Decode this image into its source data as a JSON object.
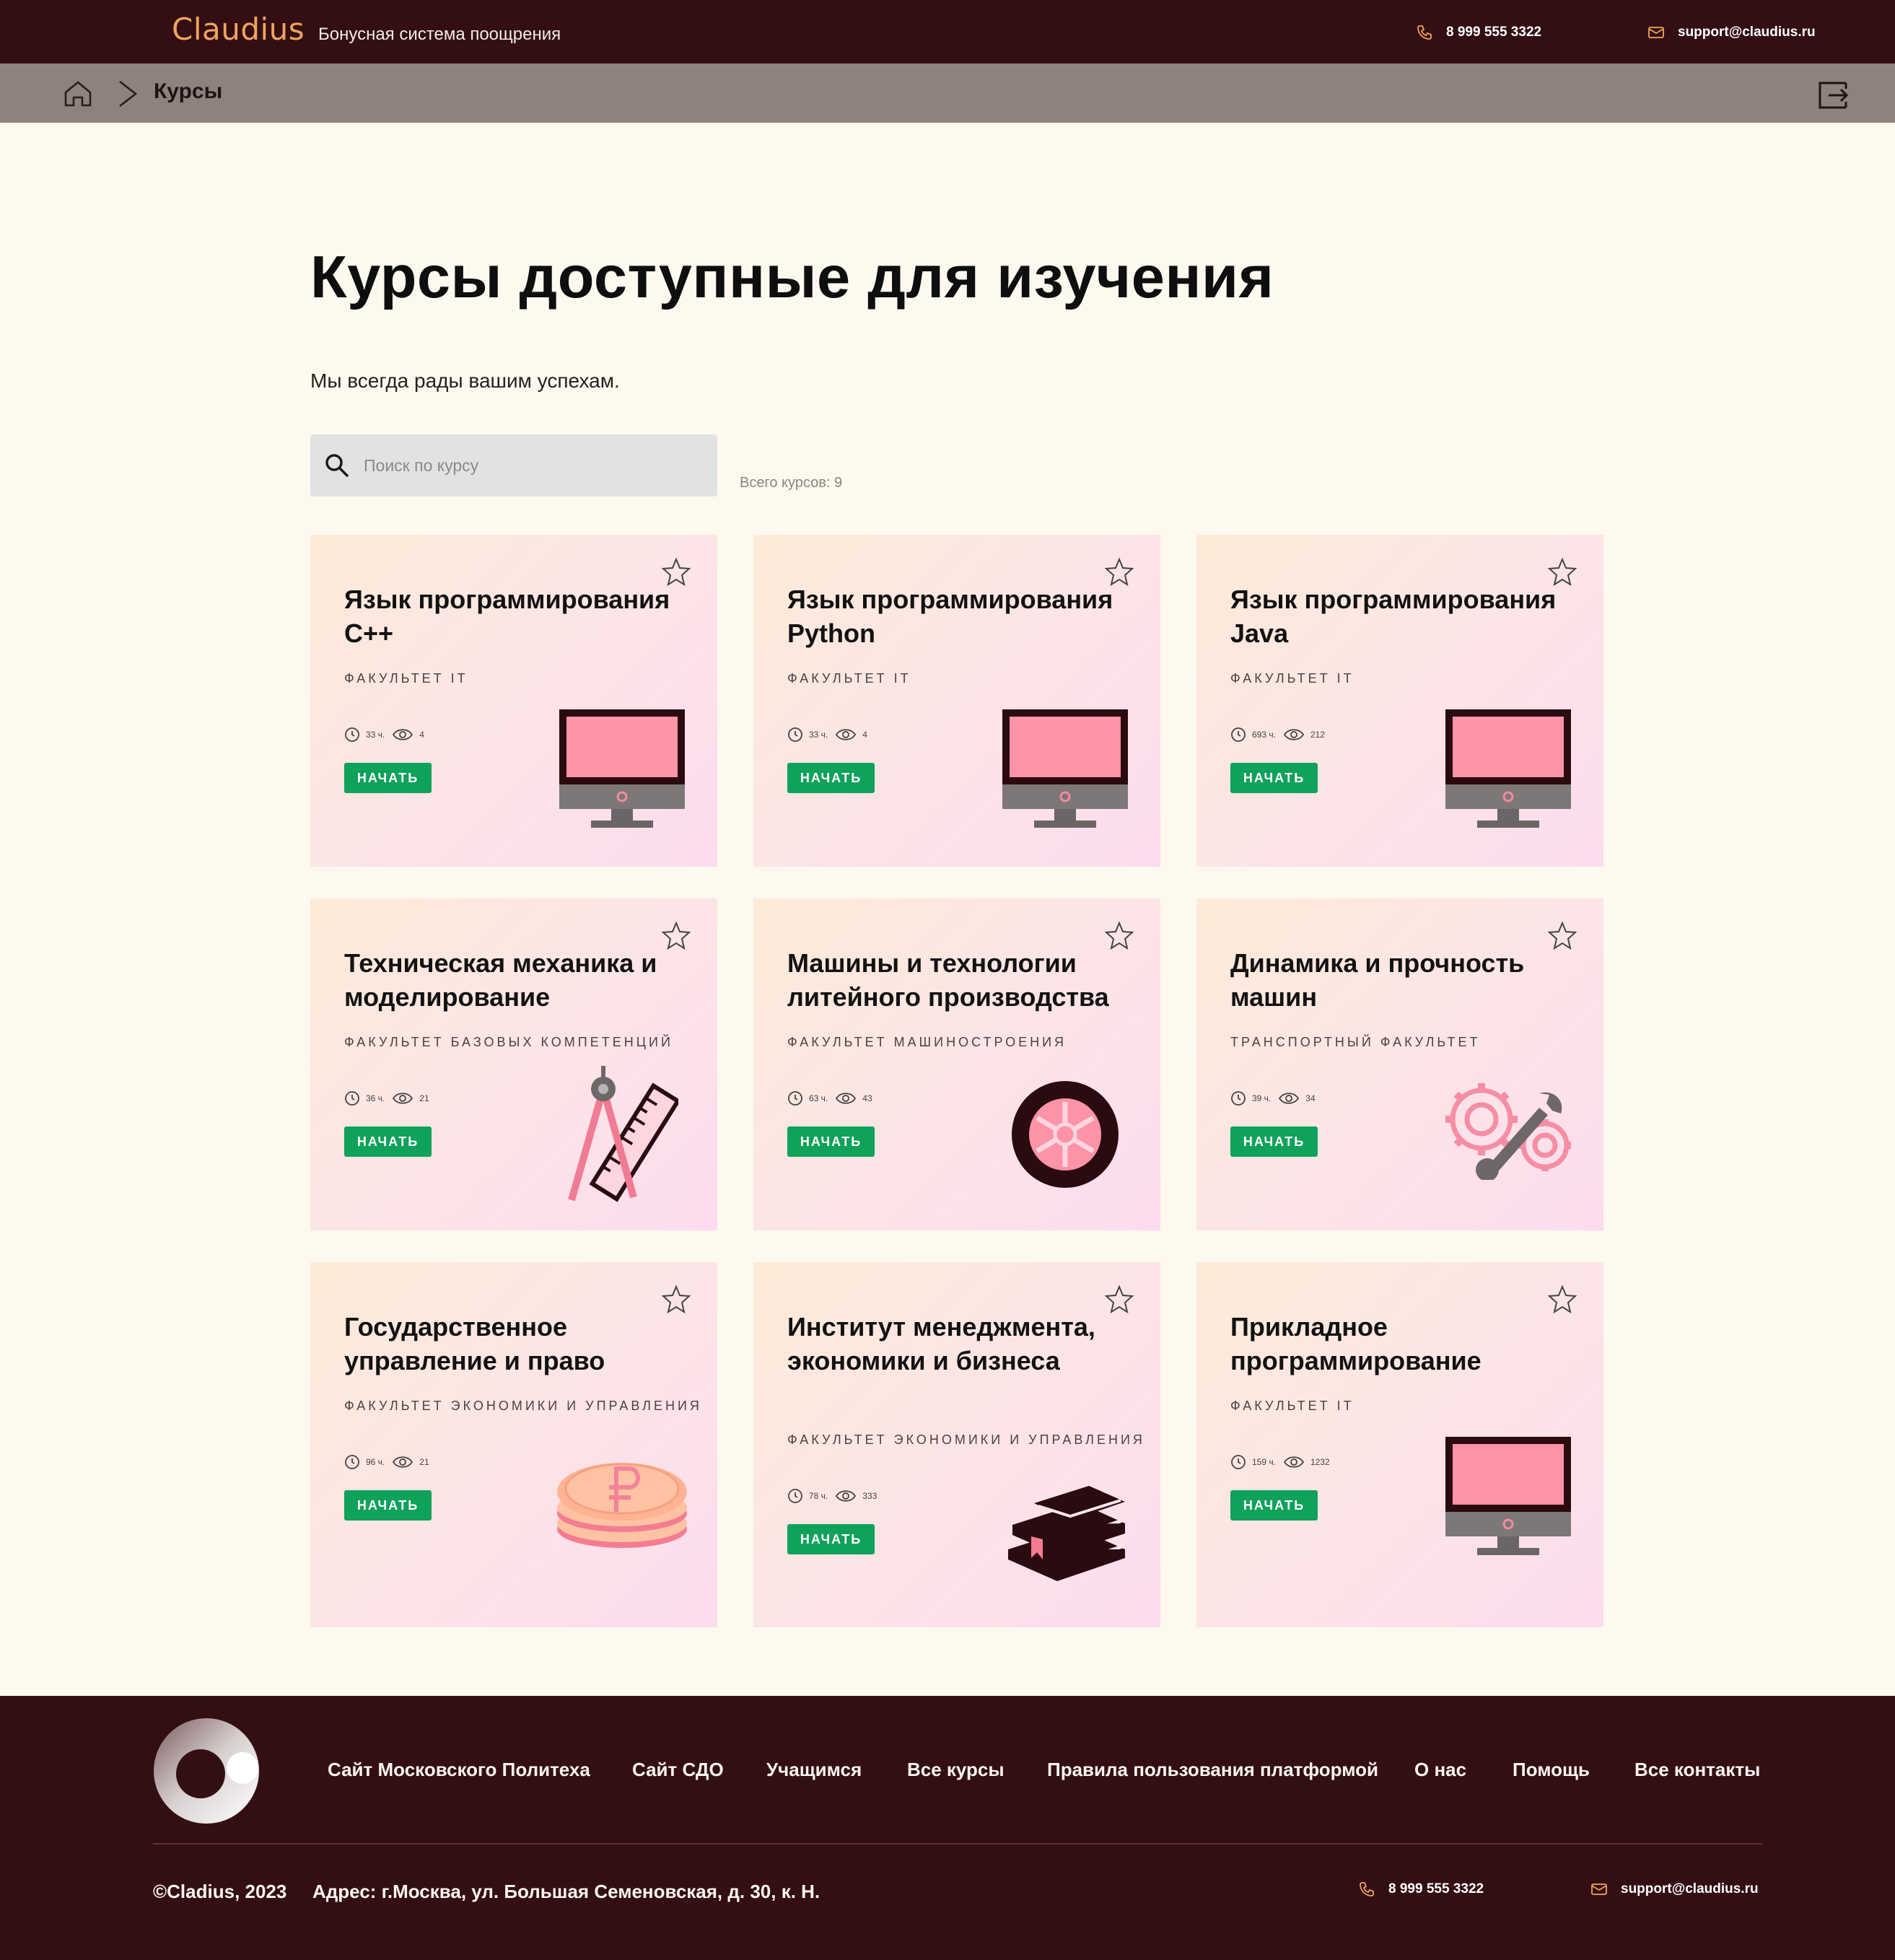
{
  "header": {
    "logo": "Claudius",
    "tagline": "Бонусная система поощрения",
    "phone": "8 999 555 3322",
    "email": "support@claudius.ru"
  },
  "breadcrumb": {
    "home_icon": "home-icon",
    "separator_icon": "chevron-right-icon",
    "current": "Курсы",
    "logout_icon": "logout-icon"
  },
  "main": {
    "title": "Курсы доступные для изучения",
    "subtitle": "Мы всегда рады вашим успехам.",
    "search_placeholder": "Поиск по курсу",
    "total": "Всего курсов: 9"
  },
  "courses": [
    {
      "title": "Язык программирования C++",
      "faculty": "ФАКУЛЬТЕТ IT",
      "hours": "33 ч.",
      "views": "4",
      "button": "НАЧАТЬ",
      "illustration": "monitor"
    },
    {
      "title": "Язык программирования Python",
      "faculty": "ФАКУЛЬТЕТ IT",
      "hours": "33 ч.",
      "views": "4",
      "button": "НАЧАТЬ",
      "illustration": "monitor"
    },
    {
      "title": "Язык программирования Java",
      "faculty": "ФАКУЛЬТЕТ IT",
      "hours": "693 ч.",
      "views": "212",
      "button": "НАЧАТЬ",
      "illustration": "monitor"
    },
    {
      "title": "Техническая механика и моделирование",
      "faculty": "ФАКУЛЬТЕТ БАЗОВЫХ КОМПЕТЕНЦИЙ",
      "hours": "36 ч.",
      "views": "21",
      "button": "НАЧАТЬ",
      "illustration": "compass-ruler"
    },
    {
      "title": "Машины и технологии литейного производства",
      "faculty": "ФАКУЛЬТЕТ МАШИНОСТРОЕНИЯ",
      "hours": "63 ч.",
      "views": "43",
      "button": "НАЧАТЬ",
      "illustration": "wheel"
    },
    {
      "title": "Динамика и прочность машин",
      "faculty": "ТРАНСПОРТНЫЙ ФАКУЛЬТЕТ",
      "hours": "39 ч.",
      "views": "34",
      "button": "НАЧАТЬ",
      "illustration": "gears-wrench"
    },
    {
      "title": "Государственное управление и право",
      "faculty": "ФАКУЛЬТЕТ ЭКОНОМИКИ И УПРАВЛЕНИЯ",
      "hours": "96 ч.",
      "views": "21",
      "button": "НАЧАТЬ",
      "illustration": "ruble-coins"
    },
    {
      "title": "Институт менеджмента, экономики и бизнеса",
      "faculty": "ФАКУЛЬТЕТ ЭКОНОМИКИ И УПРАВЛЕНИЯ",
      "hours": "78 ч.",
      "views": "333",
      "button": "НАЧАТЬ",
      "illustration": "books"
    },
    {
      "title": "Прикладное программирование",
      "faculty": "ФАКУЛЬТЕТ IT",
      "hours": "159 ч.",
      "views": "1232",
      "button": "НАЧАТЬ",
      "illustration": "monitor"
    }
  ],
  "footer": {
    "links": [
      "Сайт Московского Политеха",
      "Сайт СДО",
      "Учащимся",
      "Все курсы",
      "Правила пользования платформой",
      "О нас",
      "Помощь",
      "Все контакты"
    ],
    "copyright": "©Cladius, 2023",
    "address": "Адрес: г.Москва, ул. Большая Семеновская, д. 30, к. Н.",
    "phone": "8 999 555 3322",
    "email": "support@claudius.ru"
  },
  "colors": {
    "header_bg": "#330f14",
    "breadcrumb_bg": "#8f817c",
    "page_bg": "#fdf9ef",
    "accent_logo": "#f0a45c",
    "button_green": "#10a15a"
  }
}
